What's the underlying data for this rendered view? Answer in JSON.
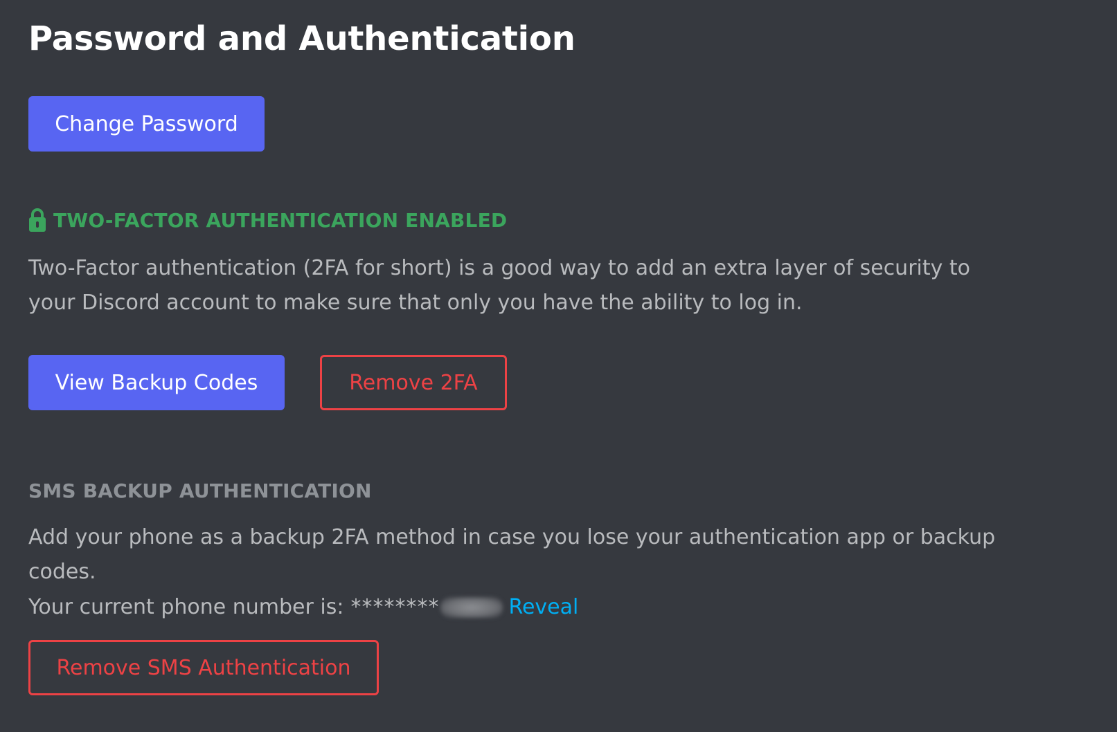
{
  "page": {
    "title": "Password and Authentication"
  },
  "buttons": {
    "change_password": "Change Password",
    "view_backup_codes": "View Backup Codes",
    "remove_2fa": "Remove 2FA",
    "remove_sms": "Remove SMS Authentication"
  },
  "two_factor": {
    "heading": "TWO-FACTOR AUTHENTICATION ENABLED",
    "icon": "lock-icon",
    "description": "Two-Factor authentication (2FA for short) is a good way to add an extra layer of security to your Discord account to make sure that only you have the ability to log in."
  },
  "sms_backup": {
    "heading": "SMS BACKUP AUTHENTICATION",
    "description": "Add your phone as a backup 2FA method in case you lose your authentication app or backup codes.",
    "phone_label": "Your current phone number is:",
    "phone_masked": "********",
    "reveal_label": "Reveal"
  },
  "colors": {
    "background": "#36393f",
    "primary": "#5865f2",
    "danger": "#ed4245",
    "success": "#3ba55d",
    "link": "#00aff4",
    "muted_heading": "#8e9297"
  }
}
